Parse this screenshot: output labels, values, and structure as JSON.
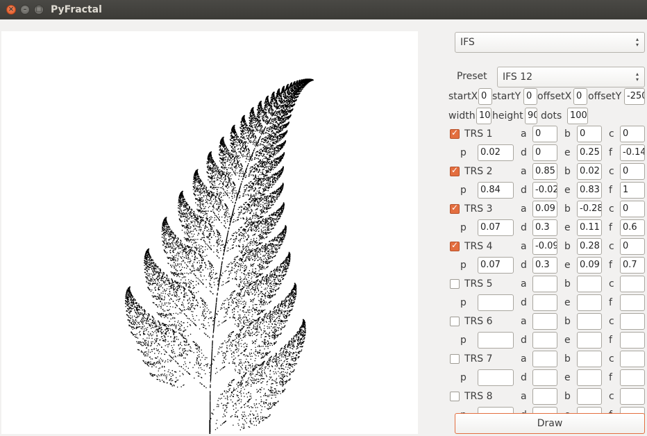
{
  "window": {
    "title": "PyFractal"
  },
  "fractal_type": "IFS",
  "preset": {
    "label": "Preset",
    "value": "IFS 12"
  },
  "params_row1": [
    {
      "label": "startX",
      "value": "0"
    },
    {
      "label": "startY",
      "value": "0"
    },
    {
      "label": "offsetX",
      "value": "0"
    },
    {
      "label": "offsetY",
      "value": "-250"
    }
  ],
  "params_row2": [
    {
      "label": "width",
      "value": "10"
    },
    {
      "label": "height",
      "value": "90"
    },
    {
      "label": "dots",
      "value": "100"
    }
  ],
  "labels": {
    "a": "a",
    "b": "b",
    "c": "c",
    "p": "p",
    "d": "d",
    "e": "e",
    "f": "f"
  },
  "transforms": [
    {
      "name": "TRS 1",
      "checked": true,
      "a": "0",
      "b": "0",
      "c": "0",
      "p": "0.02",
      "d": "0",
      "e": "0.25",
      "f": "-0.14"
    },
    {
      "name": "TRS 2",
      "checked": true,
      "a": "0.85",
      "b": "0.02",
      "c": "0",
      "p": "0.84",
      "d": "-0.02",
      "e": "0.83",
      "f": "1"
    },
    {
      "name": "TRS 3",
      "checked": true,
      "a": "0.09",
      "b": "-0.28",
      "c": "0",
      "p": "0.07",
      "d": "0.3",
      "e": "0.11",
      "f": "0.6"
    },
    {
      "name": "TRS 4",
      "checked": true,
      "a": "-0.09",
      "b": "0.28",
      "c": "0",
      "p": "0.07",
      "d": "0.3",
      "e": "0.09",
      "f": "0.7"
    },
    {
      "name": "TRS 5",
      "checked": false,
      "a": "",
      "b": "",
      "c": "",
      "p": "",
      "d": "",
      "e": "",
      "f": ""
    },
    {
      "name": "TRS 6",
      "checked": false,
      "a": "",
      "b": "",
      "c": "",
      "p": "",
      "d": "",
      "e": "",
      "f": ""
    },
    {
      "name": "TRS 7",
      "checked": false,
      "a": "",
      "b": "",
      "c": "",
      "p": "",
      "d": "",
      "e": "",
      "f": ""
    },
    {
      "name": "TRS 8",
      "checked": false,
      "a": "",
      "b": "",
      "c": "",
      "p": "",
      "d": "",
      "e": "",
      "f": ""
    }
  ],
  "draw_button": "Draw"
}
